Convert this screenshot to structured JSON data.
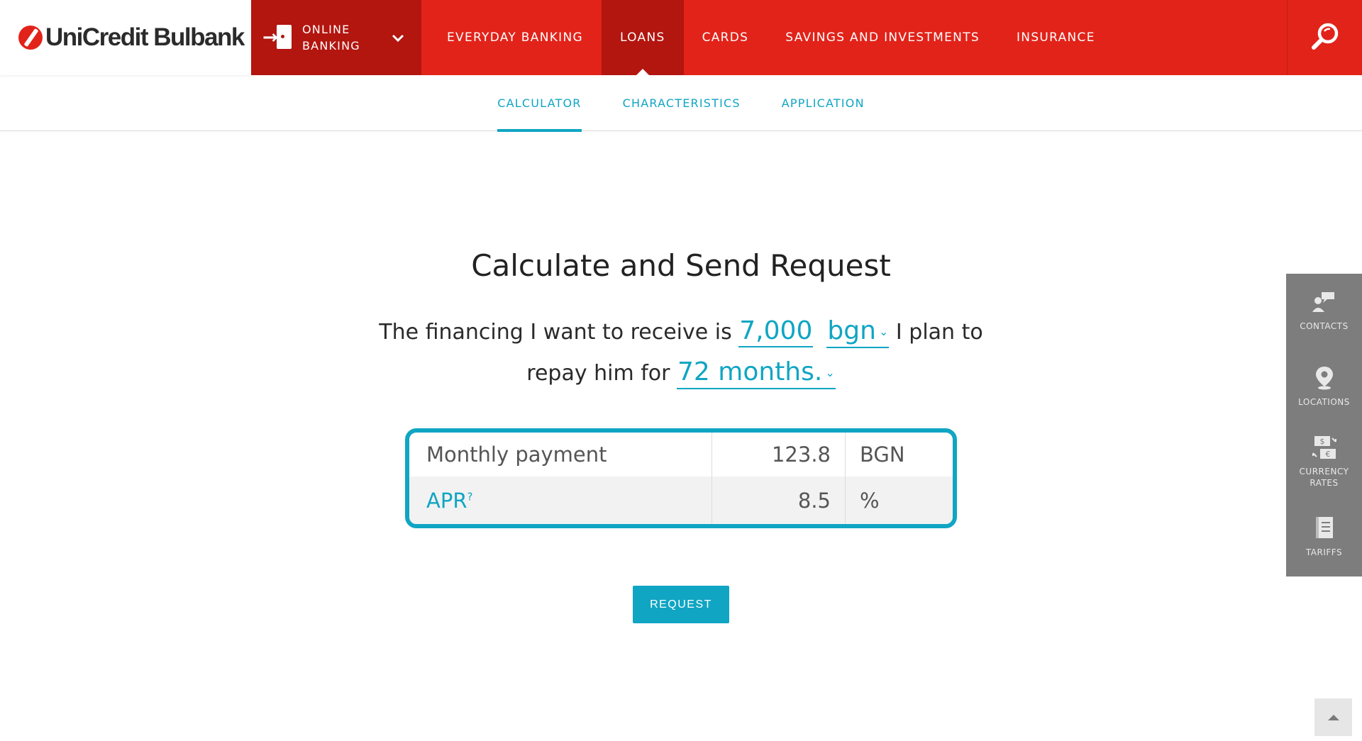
{
  "brand": {
    "logo_text": "UniCredit Bulbank"
  },
  "header": {
    "online_banking_label": "ONLINE BANKING",
    "nav": [
      {
        "label": "EVERYDAY BANKING"
      },
      {
        "label": "LOANS",
        "active": true
      },
      {
        "label": "CARDS"
      },
      {
        "label": "SAVINGS AND INVESTMENTS"
      },
      {
        "label": "INSURANCE"
      }
    ]
  },
  "subnav": {
    "items": [
      {
        "label": "CALCULATOR",
        "active": true
      },
      {
        "label": "CHARACTERISTICS"
      },
      {
        "label": "APPLICATION"
      }
    ]
  },
  "calculator": {
    "title": "Calculate and Send Request",
    "text_before_amount": "The financing I want to receive is",
    "amount": "7,000",
    "currency": "bgn",
    "text_after_currency": "I plan to",
    "text_before_period": "repay him for",
    "period": "72 months.",
    "results": [
      {
        "label": "Monthly payment",
        "value": "123.8",
        "unit": "BGN"
      },
      {
        "label": "APR",
        "label_sup": "?",
        "value": "8.5",
        "unit": "%"
      }
    ],
    "request_label": "REQUEST"
  },
  "side_panel": {
    "items": [
      {
        "label": "CONTACTS",
        "icon": "contacts-icon"
      },
      {
        "label": "LOCATIONS",
        "icon": "location-pin-icon"
      },
      {
        "label": "CURRENCY RATES",
        "icon": "currency-exchange-icon"
      },
      {
        "label": "TARIFFS",
        "icon": "tariffs-book-icon"
      }
    ]
  },
  "colors": {
    "brand_red": "#e2231a",
    "dark_red": "#b3150f",
    "accent_teal": "#10a5c3",
    "side_gray": "#7d7d7d"
  }
}
